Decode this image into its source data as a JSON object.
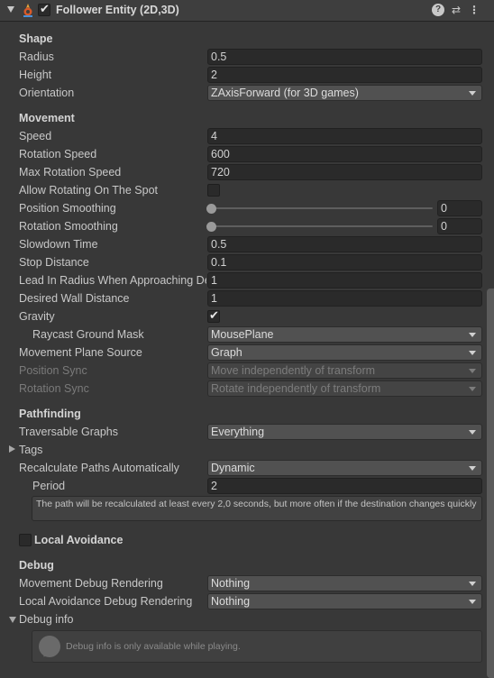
{
  "header": {
    "title": "Follower Entity (2D,3D)",
    "enabled": true,
    "help_icon": "question-circle-icon",
    "preset_icon": "sliders-icon",
    "menu_icon": "kebab-menu-icon"
  },
  "shape": {
    "heading": "Shape",
    "radius_label": "Radius",
    "radius_value": "0.5",
    "height_label": "Height",
    "height_value": "2",
    "orientation_label": "Orientation",
    "orientation_value": "ZAxisForward (for 3D games)"
  },
  "movement": {
    "heading": "Movement",
    "speed_label": "Speed",
    "speed_value": "4",
    "rotation_speed_label": "Rotation Speed",
    "rotation_speed_value": "600",
    "max_rotation_speed_label": "Max Rotation Speed",
    "max_rotation_speed_value": "720",
    "allow_rotating_label": "Allow Rotating On The Spot",
    "allow_rotating_checked": false,
    "position_smoothing_label": "Position Smoothing",
    "position_smoothing_value": "0",
    "rotation_smoothing_label": "Rotation Smoothing",
    "rotation_smoothing_value": "0",
    "slowdown_time_label": "Slowdown Time",
    "slowdown_time_value": "0.5",
    "stop_distance_label": "Stop Distance",
    "stop_distance_value": "0.1",
    "lead_in_radius_label": "Lead In Radius When Approaching Destination",
    "lead_in_radius_value": "1",
    "desired_wall_distance_label": "Desired Wall Distance",
    "desired_wall_distance_value": "1",
    "gravity_label": "Gravity",
    "gravity_checked": true,
    "raycast_mask_label": "Raycast Ground Mask",
    "raycast_mask_value": "MousePlane",
    "plane_source_label": "Movement Plane Source",
    "plane_source_value": "Graph",
    "position_sync_label": "Position Sync",
    "position_sync_value": "Move independently of transform",
    "rotation_sync_label": "Rotation Sync",
    "rotation_sync_value": "Rotate independently of transform"
  },
  "pathfinding": {
    "heading": "Pathfinding",
    "traversable_label": "Traversable Graphs",
    "traversable_value": "Everything",
    "tags_label": "Tags",
    "recalc_label": "Recalculate Paths Automatically",
    "recalc_value": "Dynamic",
    "period_label": "Period",
    "period_value": "2",
    "help_text": "The path will be recalculated at least every 2,0 seconds, but more often if the destination changes quickly"
  },
  "local_avoidance": {
    "label": "Local Avoidance",
    "checked": false
  },
  "debug": {
    "heading": "Debug",
    "movement_label": "Movement Debug Rendering",
    "movement_value": "Nothing",
    "avoidance_label": "Local Avoidance Debug Rendering",
    "avoidance_value": "Nothing",
    "info_label": "Debug info",
    "info_text": "Debug info is only available while playing."
  }
}
